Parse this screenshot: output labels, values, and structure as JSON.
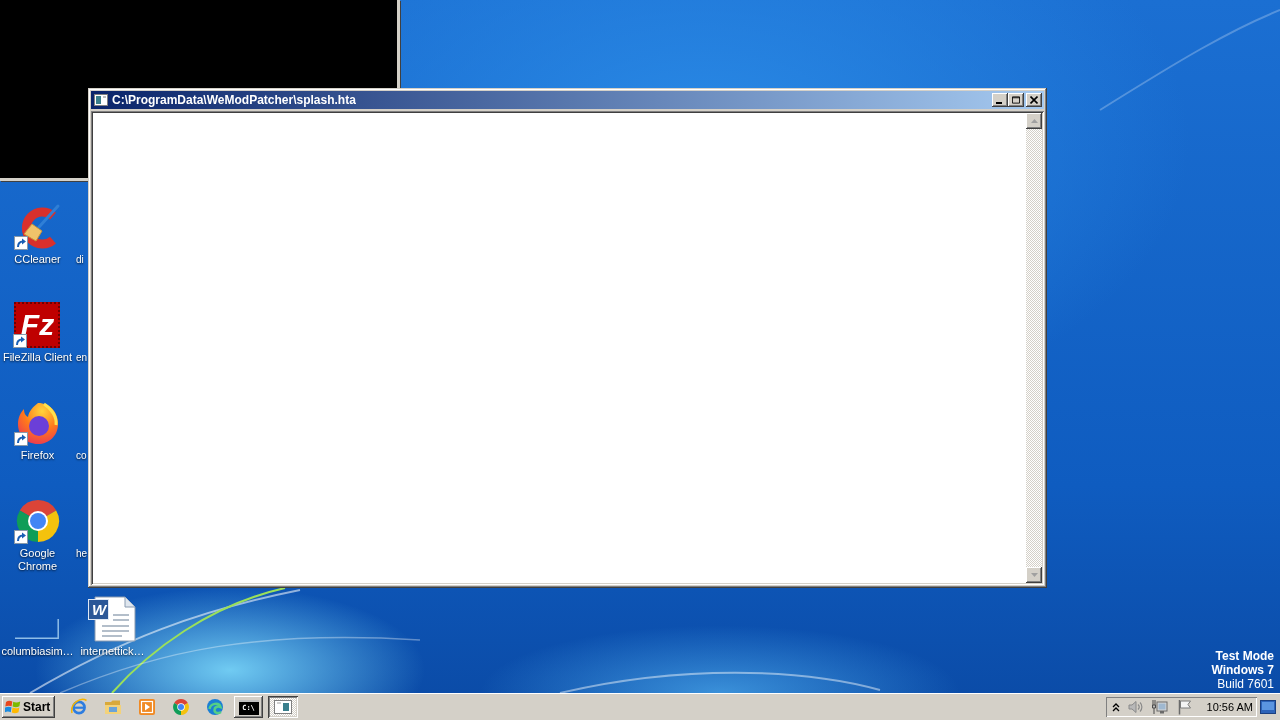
{
  "desktop": {
    "icon_columns": [
      [
        {
          "label": "CCleaner",
          "kind": "broom",
          "shortcut": true
        },
        {
          "label": "FileZilla Client",
          "kind": "tile",
          "logo_text": "Fz",
          "shortcut": true
        },
        {
          "label": "Firefox",
          "kind": "flame",
          "shortcut": true
        },
        {
          "label": "Google Chrome",
          "kind": "ring",
          "shortcut": true
        },
        {
          "label": "columbiasim…",
          "kind": "blank",
          "shortcut": false
        }
      ],
      [
        {
          "label": "di",
          "kind": "covered"
        },
        {
          "label": "en",
          "kind": "covered"
        },
        {
          "label": "co",
          "kind": "covered"
        },
        {
          "label": "he",
          "kind": "covered"
        },
        {
          "label": "internettick…",
          "kind": "document",
          "logo_text": "W",
          "shortcut": false
        }
      ]
    ]
  },
  "window": {
    "title": "C:\\ProgramData\\WeModPatcher\\splash.hta",
    "active": true
  },
  "test_mode_notice": {
    "title_lines": [
      "Test Mode",
      "Windows 7"
    ],
    "build": "Build 7601"
  },
  "taskbar": {
    "start_label": "Start",
    "task_buttons": [
      {
        "kind": "console",
        "icon_text": "C:\\",
        "selected": false
      },
      {
        "kind": "window",
        "selected": true
      }
    ],
    "clock": "10:56 AM"
  }
}
